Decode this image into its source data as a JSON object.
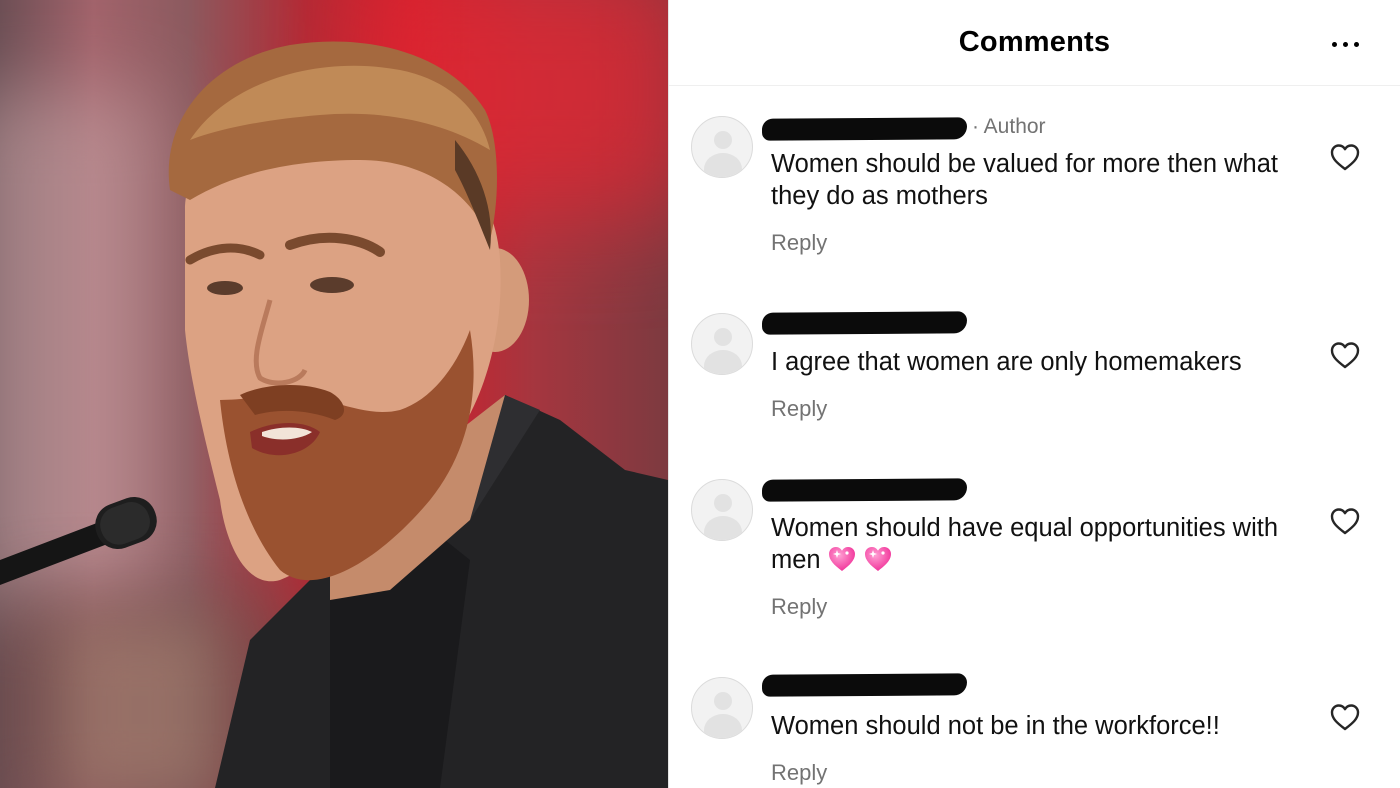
{
  "header": {
    "title": "Comments"
  },
  "comments": [
    {
      "author_tag": "· Author",
      "text": "Women should be valued for more then what they do as mothers",
      "reply_label": "Reply"
    },
    {
      "text": "I agree that women are only homemakers",
      "reply_label": "Reply"
    },
    {
      "text": "Women should have equal opportunities with men",
      "emoji": [
        "sparkling-heart",
        "sparkling-heart"
      ],
      "reply_label": "Reply"
    },
    {
      "text": "Women should not be in the workforce!!",
      "reply_label": "Reply"
    }
  ],
  "icons": {
    "menu": "more-horizontal-icon",
    "like": "heart-outline-icon",
    "avatar": "default-avatar-icon"
  },
  "colors": {
    "secondary_text": "#737373",
    "redaction": "#0b0b0b",
    "emoji_heart": "#ff3fa4"
  }
}
